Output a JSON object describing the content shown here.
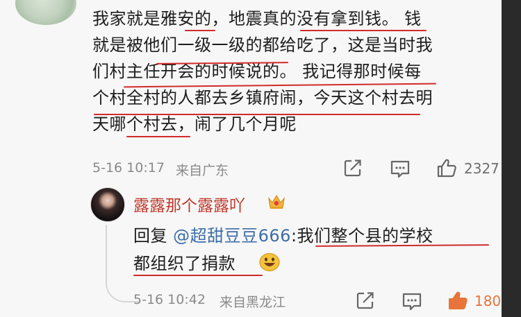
{
  "comment": {
    "lines": [
      "我家就是雅安的，地震真的没有拿到钱。 钱",
      "就是被他们一级一级的都给吃了，这是当时我",
      "们村主任开会的时候说的。 我记得那时候每",
      "个村全村的人都去乡镇府闹，今天这个村去明",
      "天哪个村去，闹了几个月呢"
    ],
    "time": "5-16 10:17",
    "location": "来自广东",
    "likes": "2327",
    "icons": [
      "share-icon",
      "comment-icon",
      "like-icon"
    ]
  },
  "reply": {
    "username": "露露那个露露吖",
    "reply_prefix": "回复 ",
    "mention": "@超甜豆豆666",
    "line1_rest": ":我们整个县的学校",
    "line2": "都组织了捐款",
    "time": "5-16 10:42",
    "location": "来自黑龙江",
    "likes": "180",
    "badge": "crown-icon",
    "emoji": "grinning-emoji"
  },
  "colors": {
    "background": "#f7f7f7",
    "text": "#1d1d1d",
    "meta": "#8a8a8a",
    "username": "#c0382b",
    "mention": "#3b6ea8",
    "underline": "#d22a2a",
    "like_active": "#e8743b"
  }
}
